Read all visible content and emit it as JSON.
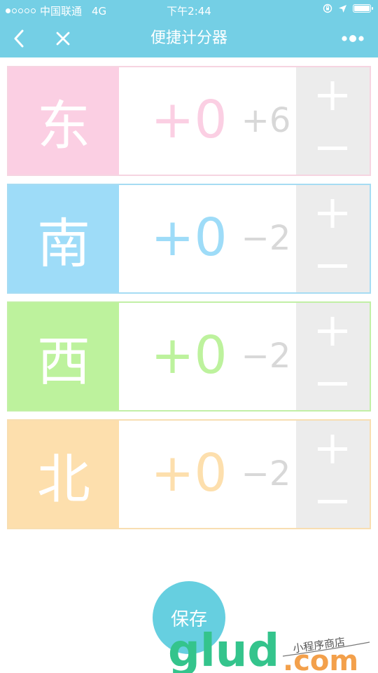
{
  "status_bar": {
    "carrier": "中国联通",
    "network": "4G",
    "time": "下午2:44"
  },
  "nav": {
    "title": "便捷计分器",
    "back_icon": "chevron-left-icon",
    "close_icon": "close-icon",
    "more_icon": "more-dots-icon"
  },
  "players": [
    {
      "seat": "东",
      "delta": "+0",
      "total": "+6",
      "colors": {
        "main": "#fbcfe3",
        "border": "#f6d4e1"
      }
    },
    {
      "seat": "南",
      "delta": "+0",
      "total": "−2",
      "colors": {
        "main": "#9edcf8",
        "border": "#a6dcf3"
      }
    },
    {
      "seat": "西",
      "delta": "+0",
      "total": "−2",
      "colors": {
        "main": "#bdf29d",
        "border": "#c2efa6"
      }
    },
    {
      "seat": "北",
      "delta": "+0",
      "total": "−2",
      "colors": {
        "main": "#fddfad",
        "border": "#f8deb1"
      }
    }
  ],
  "save_button": {
    "label": "保存"
  },
  "watermark": {
    "text": "glud",
    "suffix": ".com",
    "tagline": "小程序商店"
  }
}
